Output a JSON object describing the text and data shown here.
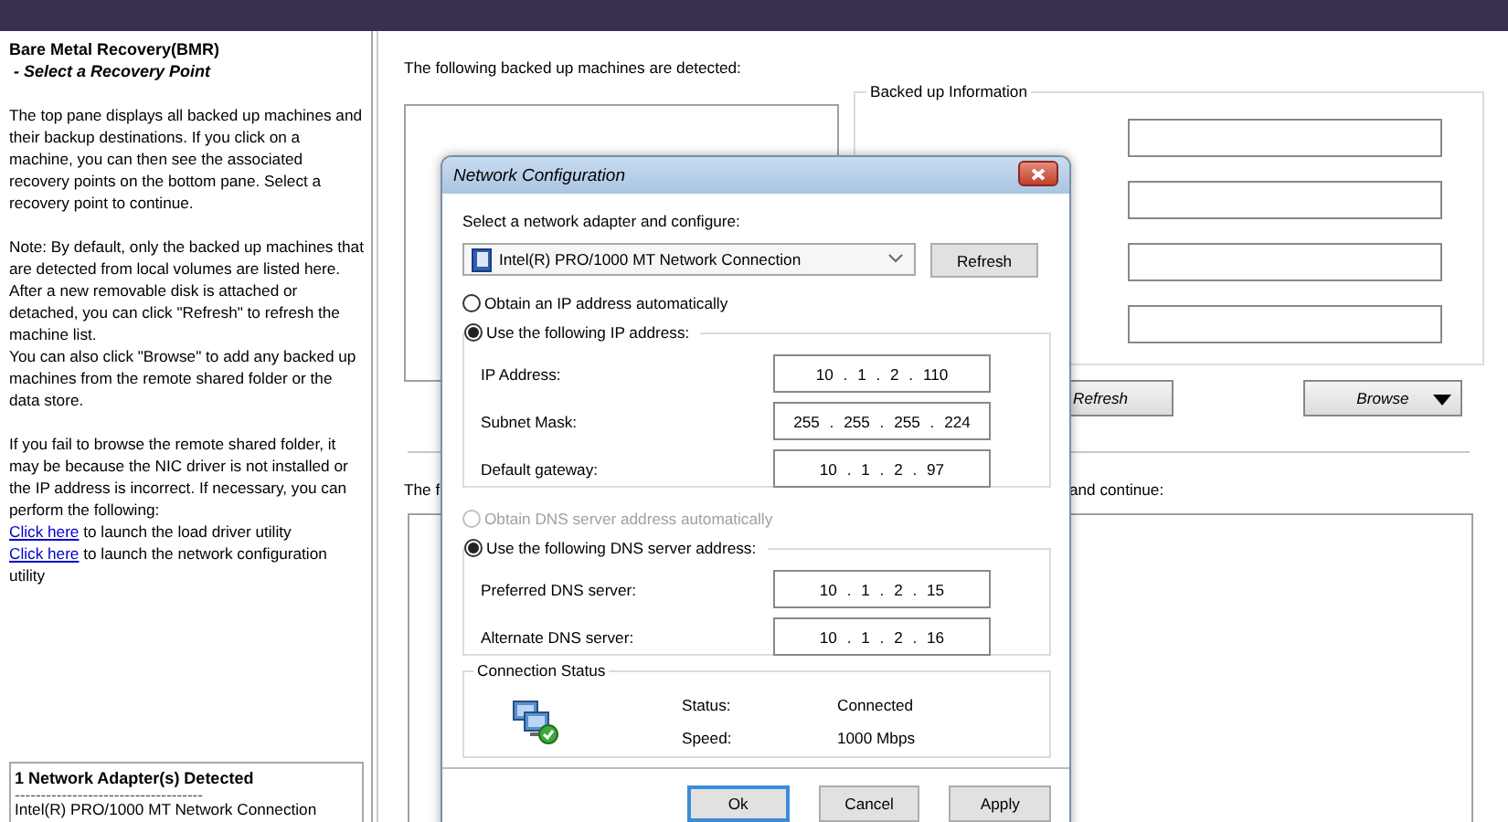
{
  "help_pane": {
    "title": "Bare Metal Recovery(BMR)",
    "subtitle": " - Select a Recovery Point",
    "paragraphs": [
      [
        {
          "text": "The top pane displays all backed up machines and their backup destinations. If you click on a machine, you can then see the associated recovery points on the bottom pane. Select a recovery point to continue."
        }
      ],
      [
        {
          "text": "Note: By default, only the backed up machines that are detected from local volumes are listed here. After a new removable disk is attached or detached, you can click \"Refresh\" to refresh the machine list."
        },
        {
          "text": "You can also click \"Browse\" to add any backed up machines from the remote shared folder or the data store."
        }
      ],
      [
        {
          "text": "If you fail to browse the remote shared folder, it may be because the NIC driver is not installed or the IP address is incorrect. If necessary, you can perform the following:"
        },
        {
          "link": "Click here",
          "text": " to launch the load driver utility"
        },
        {
          "link": "Click here",
          "text": " to launch the network configuration utility"
        }
      ]
    ],
    "adapters": {
      "title": "1 Network Adapter(s) Detected",
      "separator": "------------------------------------",
      "items": [
        "Intel(R) PRO/1000 MT Network Connection"
      ]
    }
  },
  "main": {
    "machines_label": "The following backed up machines are detected:",
    "backup_info": {
      "title": "Backed up Information",
      "fields": [
        {
          "kind": "text"
        },
        {
          "kind": "text"
        },
        {
          "kind": "text"
        },
        {
          "kind": "text"
        }
      ]
    },
    "refresh_button": "Refresh",
    "browse_button": "Browse",
    "recovery_label_left": "The f",
    "recovery_label_right": "and continue:"
  },
  "dialog": {
    "title": "Network Configuration",
    "prompt": "Select a network adapter and configure:",
    "adapter": "Intel(R) PRO/1000 MT Network Connection",
    "refresh_button": "Refresh",
    "ip_options": [
      {
        "label": "Obtain an IP address automatically",
        "selected": false,
        "disabled": false
      },
      {
        "label": "Use the following IP address:",
        "selected": true,
        "disabled": false
      }
    ],
    "ip_fields": [
      {
        "label": "IP Address:",
        "value": "10 . 1 . 2 . 110"
      },
      {
        "label": "Subnet Mask:",
        "value": "255 . 255 . 255 . 224"
      },
      {
        "label": "Default gateway:",
        "value": "10 . 1 . 2 . 97"
      }
    ],
    "dns_options": [
      {
        "label": "Obtain DNS server address automatically",
        "selected": false,
        "disabled": true
      },
      {
        "label": "Use the following DNS server address:",
        "selected": true,
        "disabled": false
      }
    ],
    "dns_fields": [
      {
        "label": "Preferred DNS server:",
        "value": "10 . 1 . 2 . 15"
      },
      {
        "label": "Alternate DNS server:",
        "value": "10 . 1 . 2 . 16"
      }
    ],
    "connection": {
      "title": "Connection Status",
      "rows": [
        {
          "label": "Status:",
          "value": "Connected"
        },
        {
          "label": "Speed:",
          "value": "1000 Mbps"
        }
      ]
    },
    "buttons": [
      {
        "label": "Ok",
        "focused": true
      },
      {
        "label": "Cancel",
        "focused": false
      },
      {
        "label": "Apply",
        "focused": false
      }
    ]
  }
}
